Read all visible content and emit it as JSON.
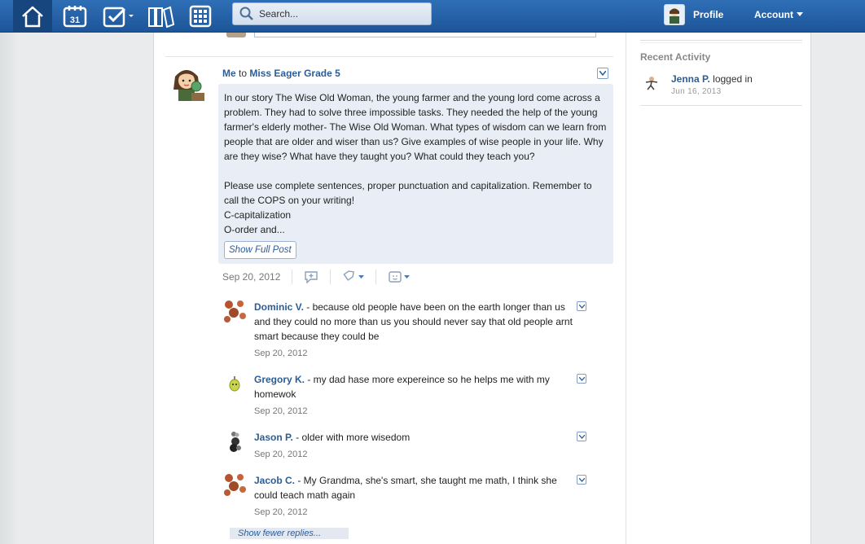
{
  "topbar": {
    "nav_icons": [
      "home-icon",
      "calendar-icon",
      "assignments-icon",
      "library-icon",
      "apps-grid-icon"
    ],
    "calendar_day": "31",
    "search_placeholder": "Search...",
    "profile_label": "Profile",
    "account_label": "Account"
  },
  "post": {
    "author": "Me",
    "to_word": "to",
    "recipient": "Miss Eager Grade 5",
    "body_p1": "In our story The Wise Old Woman, the young farmer and the young lord come across a problem. They had to solve three impossible tasks. They needed the help of the young farmer's elderly mother- The Wise Old Woman. What types of wisdom can we learn from people that are older and wiser than us? Give examples of wise people in your life. Why are they wise? What have they taught you? What could they teach you?",
    "body_p2": "Please use complete sentences, proper punctuation and capitalization. Remember to call the COPS on your writing!",
    "body_line3": "C-capitalization",
    "body_line4": "O-order and...",
    "show_full_label": "Show Full Post",
    "date": "Sep 20, 2012"
  },
  "replies": [
    {
      "name": "Dominic V.",
      "text": " - because old people have been on the earth longer than us and they could no more than us you should never say that old people arnt smart because they could be",
      "date": "Sep 20, 2012"
    },
    {
      "name": "Gregory K.",
      "text": " - my dad hase more expereince so he helps me with my homewok",
      "date": "Sep 20, 2012"
    },
    {
      "name": "Jason P.",
      "text": " - older with more wisedom",
      "date": "Sep 20, 2012"
    },
    {
      "name": "Jacob C.",
      "text": " - My Grandma, she's smart, she taught me math, I think she could teach math again",
      "date": "Sep 20, 2012"
    }
  ],
  "show_fewer_label": "Show fewer replies...",
  "sidebar": {
    "title": "Recent Activity",
    "activity": {
      "name": "Jenna P.",
      "action": " logged in",
      "date": "Jun 16, 2013"
    }
  },
  "colors": {
    "topbar": "#1d5599",
    "link": "#2b5d97",
    "post_bg": "#e9eef6"
  }
}
